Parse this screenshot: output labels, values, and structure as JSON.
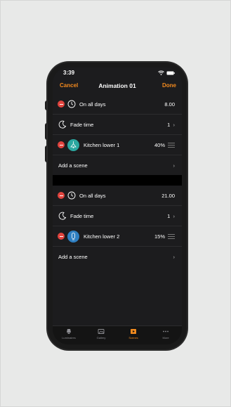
{
  "status_bar": {
    "time": "3:39"
  },
  "nav": {
    "cancel": "Cancel",
    "title": "Animation 01",
    "done": "Done"
  },
  "colors": {
    "accent": "#f28a1e",
    "delete": "#e0443e",
    "teal": "#2ba7a0",
    "blue": "#2f7fc1"
  },
  "group1": {
    "schedule": {
      "label": "On all days",
      "value": "8.00",
      "icon": "clock-icon"
    },
    "fade": {
      "label": "Fade time",
      "value": "1",
      "icon": "moon-icon"
    },
    "scene": {
      "label": "Kitchen lower 1",
      "value": "40%",
      "icon": "pendant-lamp-icon"
    },
    "add": {
      "label": "Add a scene"
    }
  },
  "group2": {
    "schedule": {
      "label": "On all days",
      "value": "21.00",
      "icon": "clock-icon"
    },
    "fade": {
      "label": "Fade time",
      "value": "1",
      "icon": "moon-icon"
    },
    "scene": {
      "label": "Kitchen lower 2",
      "value": "15%",
      "icon": "bulb-icon"
    },
    "add": {
      "label": "Add a scene"
    }
  },
  "tabs": [
    {
      "label": "Luminaires",
      "icon": "luminaire-icon",
      "active": false
    },
    {
      "label": "Gallery",
      "icon": "gallery-icon",
      "active": false
    },
    {
      "label": "Scenes",
      "icon": "scenes-icon",
      "active": true
    },
    {
      "label": "More",
      "icon": "more-icon",
      "active": false
    }
  ]
}
